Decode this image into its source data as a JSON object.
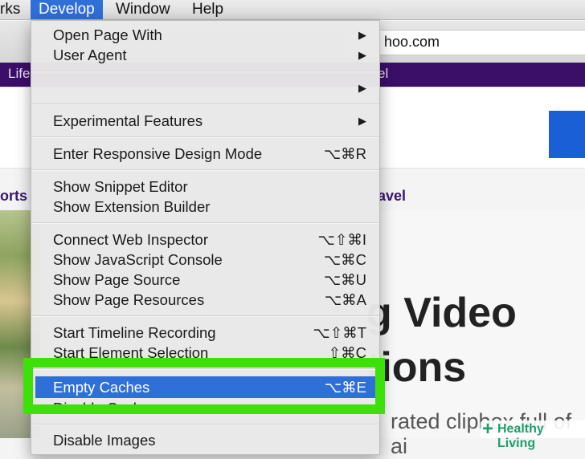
{
  "menubar": {
    "items": [
      {
        "label": "rks"
      },
      {
        "label": "Develop"
      },
      {
        "label": "Window"
      },
      {
        "label": "Help"
      }
    ]
  },
  "browser": {
    "url_fragment": "hoo.com",
    "nav_left": "Life",
    "nav_right": "el",
    "sub_left": "orts",
    "sub_right": "avel",
    "headline_1": "g Video",
    "headline_2": "tions",
    "body_text": "rated clipbox full of ai"
  },
  "menu": {
    "open_page_with": {
      "label": "Open Page With",
      "arrow": "▶"
    },
    "user_agent": {
      "label": "User Agent",
      "arrow": "▶"
    },
    "blank_item": {
      "label": "",
      "arrow": "▶"
    },
    "experimental": {
      "label": "Experimental Features",
      "arrow": "▶"
    },
    "responsive": {
      "label": "Enter Responsive Design Mode",
      "shortcut": "⌥⌘R"
    },
    "snippet": {
      "label": "Show Snippet Editor"
    },
    "extension": {
      "label": "Show Extension Builder"
    },
    "connect_inspector": {
      "label": "Connect Web Inspector",
      "shortcut": "⌥⇧⌘I"
    },
    "js_console": {
      "label": "Show JavaScript Console",
      "shortcut": "⌥⌘C"
    },
    "page_source": {
      "label": "Show Page Source",
      "shortcut": "⌥⌘U"
    },
    "page_resources": {
      "label": "Show Page Resources",
      "shortcut": "⌥⌘A"
    },
    "timeline": {
      "label": "Start Timeline Recording",
      "shortcut": "⌥⇧⌘T"
    },
    "element_selection": {
      "label": "Start Element Selection",
      "shortcut": "⇧⌘C"
    },
    "empty_caches": {
      "label": "Empty Caches",
      "shortcut": "⌥⌘E"
    },
    "disable_caches": {
      "label": "Disable Caches"
    },
    "disable_images": {
      "label": "Disable Images"
    }
  },
  "highlight_color": "#3ee00a",
  "selection_color": "#2f6fd8",
  "watermark": {
    "plus": "+",
    "text": "Healthy Living"
  }
}
